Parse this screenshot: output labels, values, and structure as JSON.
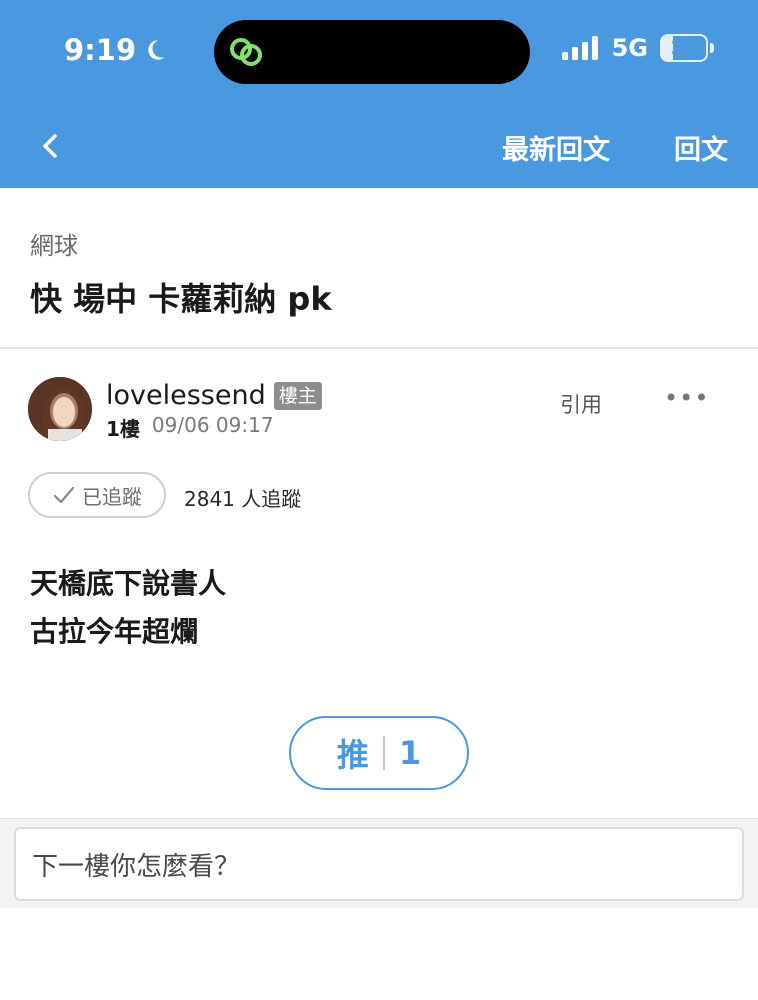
{
  "status_bar": {
    "time": "9:19",
    "network": "5G",
    "battery_level": "25",
    "icons": [
      "moon-icon",
      "app-indicator-icon",
      "signal-icon",
      "battery-icon"
    ]
  },
  "nav": {
    "back_icon": "chevron-left-icon",
    "latest_reply": "最新回文",
    "reply": "回文"
  },
  "topic": {
    "board": "網球",
    "title": "快 場中 卡蘿莉納 pk"
  },
  "post": {
    "username": "lovelessend",
    "op_badge": "樓主",
    "floor": "1樓",
    "datetime": "09/06 09:17",
    "quote_label": "引用",
    "more_label": "•••",
    "follow": {
      "label": "已追蹤",
      "count_text": "2841 人追蹤"
    },
    "body_lines": [
      "天橋底下說書人",
      "古拉今年超爛"
    ],
    "push": {
      "label": "推",
      "count": "1"
    }
  },
  "reply_bar": {
    "placeholder": "下一樓你怎麼看？"
  },
  "colors": {
    "primary": "#4a98e0",
    "badge_gray": "#8d8d8d",
    "divider": "#e3e3e3"
  }
}
